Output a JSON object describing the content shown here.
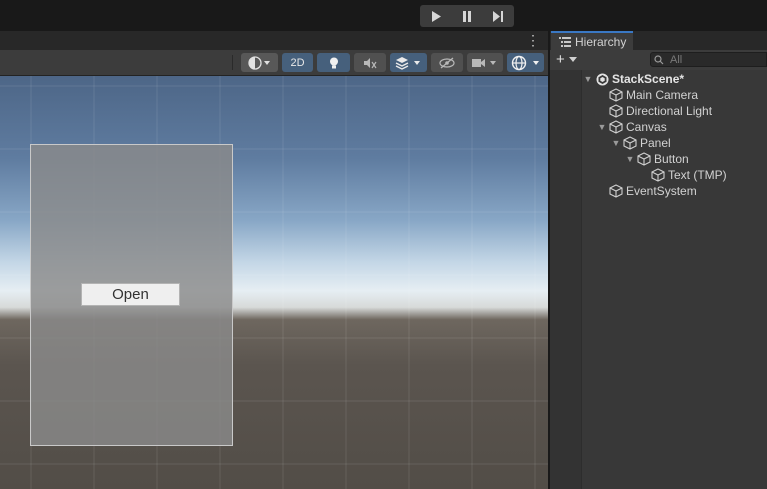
{
  "toolbar": {
    "play_icon": "play-icon",
    "pause_icon": "pause-icon",
    "step_icon": "step-icon"
  },
  "scene_view": {
    "more_menu": "⋮",
    "toolbar": {
      "shading_icon": "shading-mode-icon",
      "mode_2d_label": "2D",
      "lighting_icon": "lightbulb-icon",
      "audio_icon": "audio-mute-icon",
      "effects_icon": "effects-layers-icon",
      "visibility_icon": "scene-visibility-icon",
      "camera_icon": "camera-icon",
      "gizmos_icon": "gizmos-icon"
    },
    "game_ui": {
      "button_label": "Open"
    }
  },
  "hierarchy": {
    "tab_label": "Hierarchy",
    "add_label": "+",
    "search_placeholder": "All",
    "items": [
      {
        "label": "StackScene*",
        "depth": 0,
        "expanded": true,
        "kind": "scene"
      },
      {
        "label": "Main Camera",
        "depth": 1,
        "expanded": null,
        "kind": "object"
      },
      {
        "label": "Directional Light",
        "depth": 1,
        "expanded": null,
        "kind": "object"
      },
      {
        "label": "Canvas",
        "depth": 1,
        "expanded": true,
        "kind": "object"
      },
      {
        "label": "Panel",
        "depth": 2,
        "expanded": true,
        "kind": "object"
      },
      {
        "label": "Button",
        "depth": 3,
        "expanded": true,
        "kind": "object"
      },
      {
        "label": "Text (TMP)",
        "depth": 4,
        "expanded": null,
        "kind": "object"
      },
      {
        "label": "EventSystem",
        "depth": 1,
        "expanded": null,
        "kind": "object"
      }
    ]
  },
  "colors": {
    "accent": "#3a78c4",
    "active_toggle": "#46607c"
  }
}
